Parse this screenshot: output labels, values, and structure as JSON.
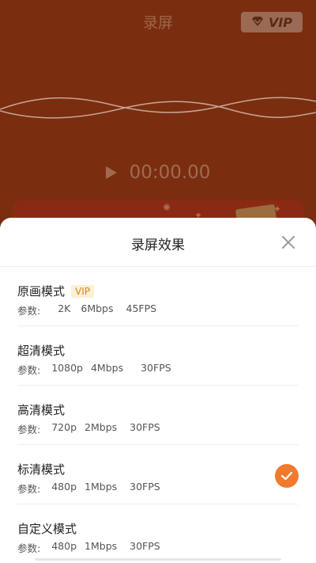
{
  "app": {
    "title": "录屏",
    "vip_label": "VIP",
    "timer": "00:00.00"
  },
  "sheet": {
    "title": "录屏效果",
    "params_label": "参数:",
    "modes": [
      {
        "name": "原画模式",
        "tag": "VIP",
        "resolution": "2K",
        "bitrate": "6Mbps",
        "fps": "45FPS",
        "selected": false
      },
      {
        "name": "超清模式",
        "tag": "",
        "resolution": "1080p",
        "bitrate": "4Mbps",
        "fps": "30FPS",
        "selected": false
      },
      {
        "name": "高清模式",
        "tag": "",
        "resolution": "720p",
        "bitrate": "2Mbps",
        "fps": "30FPS",
        "selected": false
      },
      {
        "name": "标清模式",
        "tag": "",
        "resolution": "480p",
        "bitrate": "1Mbps",
        "fps": "30FPS",
        "selected": true
      },
      {
        "name": "自定义模式",
        "tag": "",
        "resolution": "480p",
        "bitrate": "1Mbps",
        "fps": "30FPS",
        "selected": false
      }
    ]
  },
  "colors": {
    "background": "#7a2e0f",
    "accent": "#f07a2f",
    "vip_tag": "#d08a1a"
  },
  "icons": [
    "diamond-icon",
    "play-icon",
    "close-icon",
    "check-icon"
  ]
}
